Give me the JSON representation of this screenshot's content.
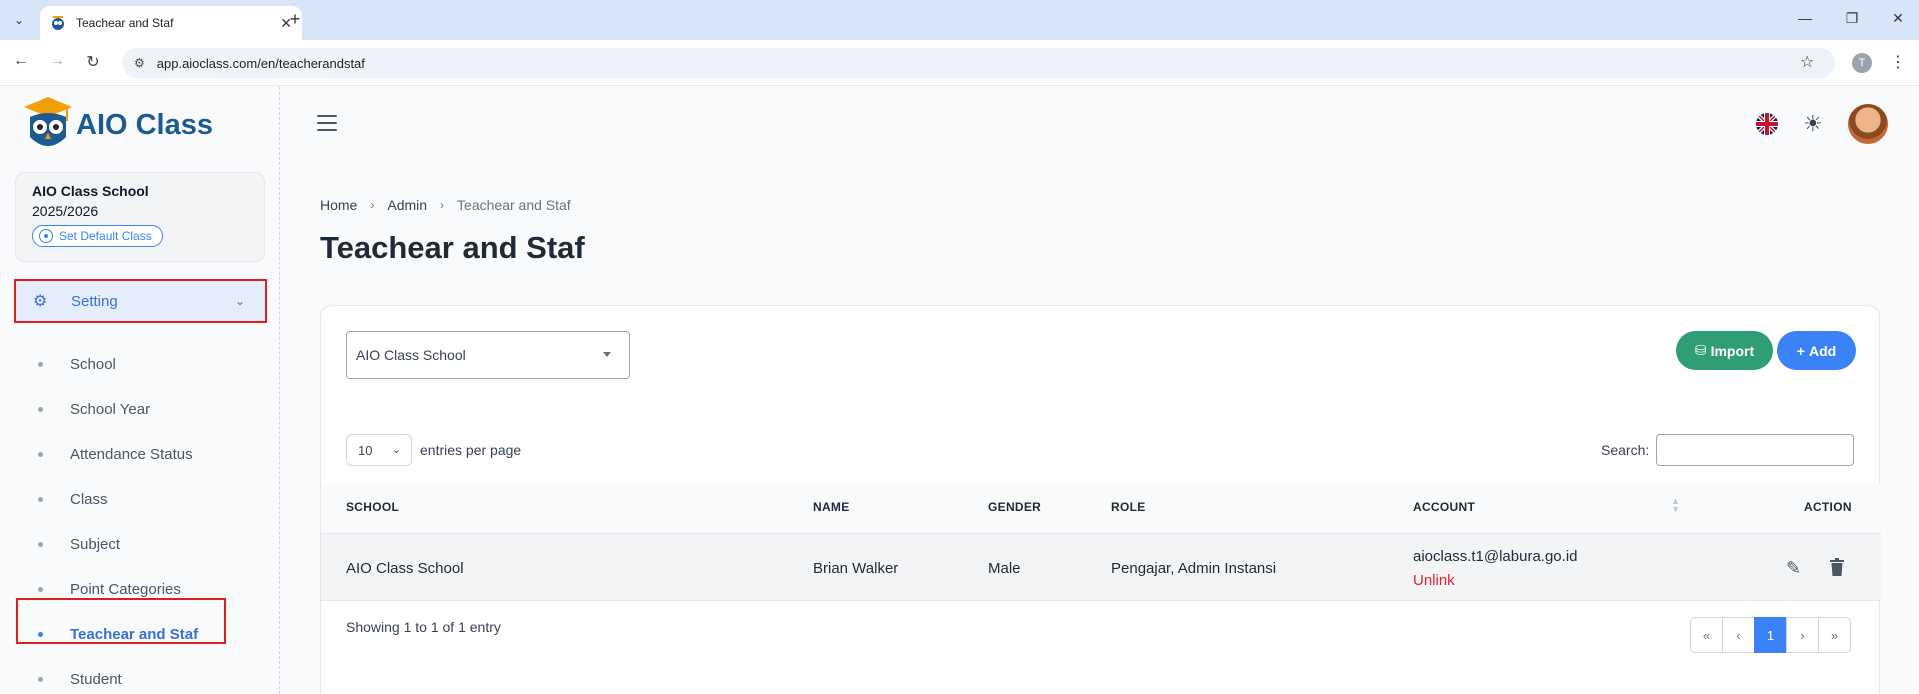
{
  "browser": {
    "tab_title": "Teachear and Staf",
    "new_tab": "+",
    "url": "app.aioclass.com/en/teacherandstaf",
    "profile_initial": "T"
  },
  "sidebar": {
    "brand": "AIO Class",
    "school_name": "AIO Class School",
    "school_year": "2025/2026",
    "default_class_label": "Set Default Class",
    "setting_label": "Setting",
    "items": [
      {
        "label": "School"
      },
      {
        "label": "School Year"
      },
      {
        "label": "Attendance Status"
      },
      {
        "label": "Class"
      },
      {
        "label": "Subject"
      },
      {
        "label": "Point Categories"
      },
      {
        "label": "Teachear and Staf",
        "active": true
      },
      {
        "label": "Student"
      }
    ]
  },
  "breadcrumb": {
    "home": "Home",
    "admin": "Admin",
    "current": "Teachear and Staf"
  },
  "page_title": "Teachear and Staf",
  "filter": {
    "school_selected": "AIO Class School"
  },
  "buttons": {
    "import": "Import",
    "add": "Add"
  },
  "table_controls": {
    "entries_value": "10",
    "entries_label": "entries per page",
    "search_label": "Search:"
  },
  "table": {
    "headers": {
      "school": "SCHOOL",
      "name": "NAME",
      "gender": "GENDER",
      "role": "ROLE",
      "account": "ACCOUNT",
      "action": "ACTION"
    },
    "rows": [
      {
        "school": "AIO Class School",
        "name": "Brian Walker",
        "gender": "Male",
        "role": "Pengajar, Admin Instansi",
        "account": "aioclass.t1@labura.go.id",
        "unlink": "Unlink"
      }
    ]
  },
  "footer": {
    "showing": "Showing 1 to 1 of 1 entry",
    "pages": [
      "«",
      "‹",
      "1",
      "›",
      "»"
    ],
    "active_page": "1"
  },
  "colors": {
    "primary": "#3b82f6",
    "import_green": "#2f9e73",
    "brand_blue": "#1d5a8e",
    "highlight_red": "#e11d1d",
    "unlink_red": "#dc2626"
  }
}
